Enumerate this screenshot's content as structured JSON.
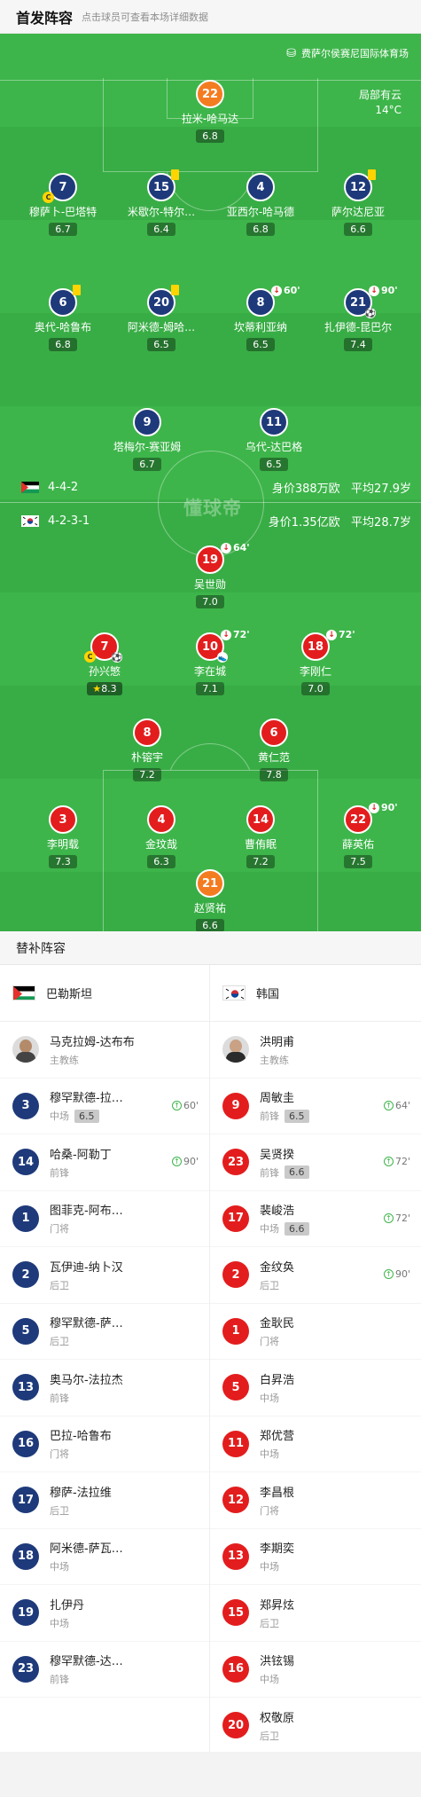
{
  "header": {
    "title": "首发阵容",
    "subtitle": "点击球员可查看本场详细数据"
  },
  "pitch": {
    "venue": "费萨尔侯赛尼国际体育场",
    "weather": "局部有云",
    "temp": "14°C",
    "watermark": "懂球帝",
    "home": {
      "formation": "4-4-2",
      "value": "身价388万欧",
      "age": "平均27.9岁"
    },
    "away": {
      "formation": "4-2-3-1",
      "value": "身价1.35亿欧",
      "age": "平均28.7岁"
    }
  },
  "home_players": [
    {
      "num": "22",
      "name": "拉米-哈马达",
      "rating": "6.8"
    },
    {
      "num": "7",
      "name": "穆萨卜-巴塔特",
      "rating": "6.7"
    },
    {
      "num": "15",
      "name": "米歇尔-特尔…",
      "rating": "6.4"
    },
    {
      "num": "4",
      "name": "亚西尔-哈马德",
      "rating": "6.8"
    },
    {
      "num": "12",
      "name": "萨尔达尼亚",
      "rating": "6.6"
    },
    {
      "num": "6",
      "name": "奥代-哈鲁布",
      "rating": "6.8"
    },
    {
      "num": "20",
      "name": "阿米德-姆哈…",
      "rating": "6.5"
    },
    {
      "num": "8",
      "name": "坎蒂利亚纳",
      "rating": "6.5",
      "sub": "60'"
    },
    {
      "num": "21",
      "name": "扎伊德-昆巴尔",
      "rating": "7.4",
      "sub": "90'"
    },
    {
      "num": "9",
      "name": "塔梅尔-赛亚姆",
      "rating": "6.7"
    },
    {
      "num": "11",
      "name": "乌代-达巴格",
      "rating": "6.5"
    }
  ],
  "away_players": [
    {
      "num": "19",
      "name": "吴世勋",
      "rating": "7.0",
      "sub": "64'"
    },
    {
      "num": "7",
      "name": "孙兴慜",
      "rating": "8.3"
    },
    {
      "num": "10",
      "name": "李在城",
      "rating": "7.1",
      "sub": "72'"
    },
    {
      "num": "18",
      "name": "李刚仁",
      "rating": "7.0",
      "sub": "72'"
    },
    {
      "num": "8",
      "name": "朴镕宇",
      "rating": "7.2"
    },
    {
      "num": "6",
      "name": "黄仁范",
      "rating": "7.8"
    },
    {
      "num": "3",
      "name": "李明载",
      "rating": "7.3"
    },
    {
      "num": "4",
      "name": "金玟哉",
      "rating": "6.3"
    },
    {
      "num": "14",
      "name": "曹侑眠",
      "rating": "7.2"
    },
    {
      "num": "22",
      "name": "薛英佑",
      "rating": "7.5",
      "sub": "90'"
    },
    {
      "num": "21",
      "name": "赵贤祐",
      "rating": "6.6"
    }
  ],
  "subs": {
    "title": "替补阵容",
    "home": {
      "team": "巴勒斯坦",
      "coach": {
        "name": "马克拉姆-达布布",
        "role": "主教练"
      },
      "players": [
        {
          "num": "3",
          "name": "穆罕默德-拉…",
          "pos": "中场",
          "rating": "6.5",
          "time": "60'"
        },
        {
          "num": "14",
          "name": "哈桑-阿勒丁",
          "pos": "前锋",
          "time": "90'"
        },
        {
          "num": "1",
          "name": "图菲克-阿布…",
          "pos": "门将"
        },
        {
          "num": "2",
          "name": "瓦伊迪-纳卜汉",
          "pos": "后卫"
        },
        {
          "num": "5",
          "name": "穆罕默德-萨…",
          "pos": "后卫"
        },
        {
          "num": "13",
          "name": "奥马尔-法拉杰",
          "pos": "前锋"
        },
        {
          "num": "16",
          "name": "巴拉-哈鲁布",
          "pos": "门将"
        },
        {
          "num": "17",
          "name": "穆萨-法拉维",
          "pos": "后卫"
        },
        {
          "num": "18",
          "name": "阿米德-萨瓦…",
          "pos": "中场"
        },
        {
          "num": "19",
          "name": "扎伊丹",
          "pos": "中场"
        },
        {
          "num": "23",
          "name": "穆罕默德-达…",
          "pos": "前锋"
        }
      ]
    },
    "away": {
      "team": "韩国",
      "coach": {
        "name": "洪明甫",
        "role": "主教练"
      },
      "players": [
        {
          "num": "9",
          "name": "周敏圭",
          "pos": "前锋",
          "rating": "6.5",
          "time": "64'"
        },
        {
          "num": "23",
          "name": "吴贤揆",
          "pos": "前锋",
          "rating": "6.6",
          "time": "72'"
        },
        {
          "num": "17",
          "name": "裴峻浩",
          "pos": "中场",
          "rating": "6.6",
          "time": "72'"
        },
        {
          "num": "2",
          "name": "金纹奂",
          "pos": "后卫",
          "time": "90'"
        },
        {
          "num": "1",
          "name": "金耿民",
          "pos": "门将"
        },
        {
          "num": "5",
          "name": "白昇浩",
          "pos": "中场"
        },
        {
          "num": "11",
          "name": "郑优营",
          "pos": "中场"
        },
        {
          "num": "12",
          "name": "李昌根",
          "pos": "门将"
        },
        {
          "num": "13",
          "name": "李期奕",
          "pos": "中场"
        },
        {
          "num": "15",
          "name": "郑昇炫",
          "pos": "后卫"
        },
        {
          "num": "16",
          "name": "洪铉锡",
          "pos": "中场"
        },
        {
          "num": "20",
          "name": "权敬原",
          "pos": "后卫"
        }
      ]
    }
  },
  "colors": {
    "pitch": "#3db54a",
    "home": "#1e3a7a",
    "away": "#e31d1d",
    "keeper": "#f47c20"
  }
}
